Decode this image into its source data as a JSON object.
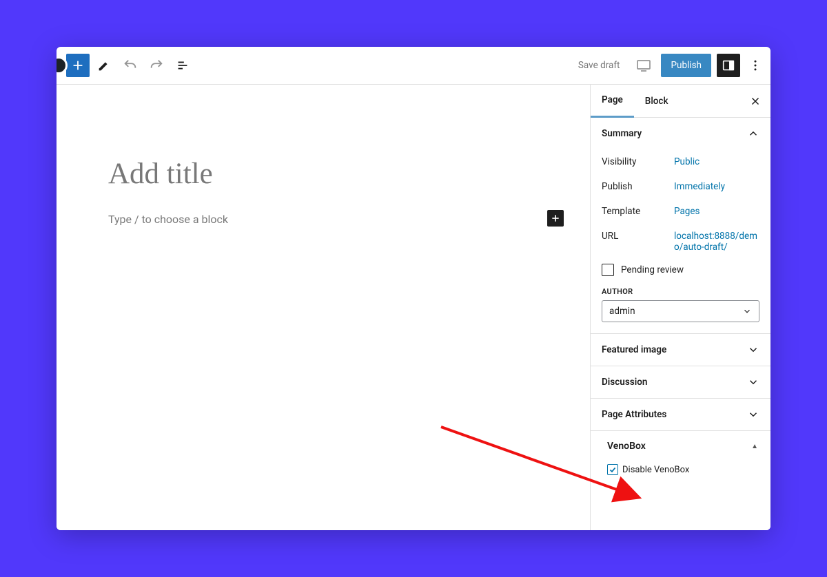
{
  "toolbar": {
    "save_draft": "Save draft",
    "publish": "Publish"
  },
  "editor": {
    "title_placeholder": "Add title",
    "block_prompt": "Type / to choose a block"
  },
  "sidebar": {
    "tabs": {
      "page": "Page",
      "block": "Block"
    },
    "summary": {
      "title": "Summary",
      "visibility_label": "Visibility",
      "visibility_value": "Public",
      "publish_label": "Publish",
      "publish_value": "Immediately",
      "template_label": "Template",
      "template_value": "Pages",
      "url_label": "URL",
      "url_value": "localhost:8888/demo/auto-draft/",
      "pending_review": "Pending review",
      "author_label": "AUTHOR",
      "author_value": "admin"
    },
    "panels": {
      "featured_image": "Featured image",
      "discussion": "Discussion",
      "page_attributes": "Page Attributes",
      "venobox": "VenoBox",
      "disable_venobox": "Disable VenoBox"
    }
  }
}
